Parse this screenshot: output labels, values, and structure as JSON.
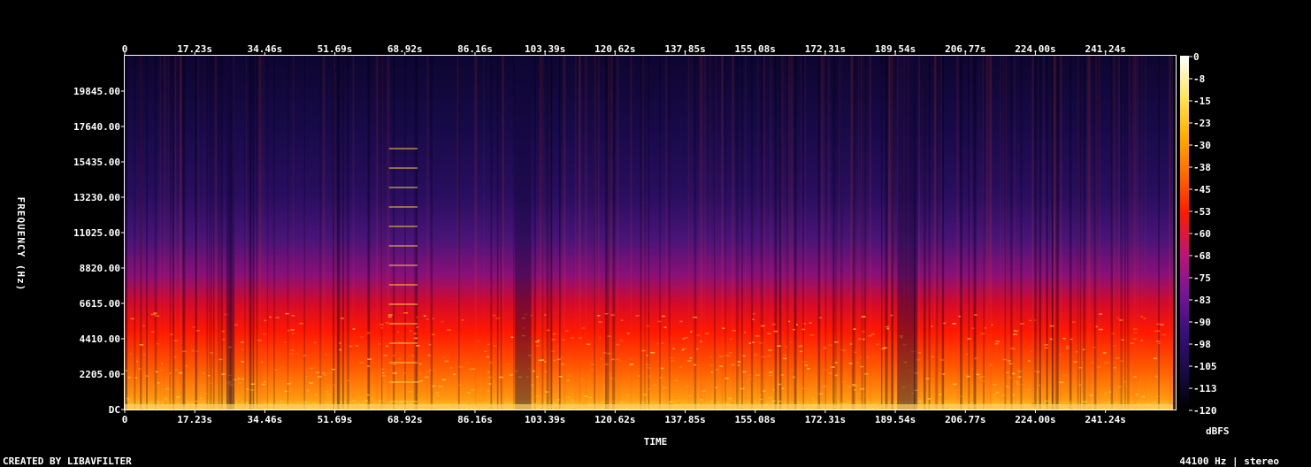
{
  "chart_data": {
    "type": "heatmap",
    "title": "",
    "xlabel": "TIME",
    "ylabel": "FREQUENCY (Hz)",
    "x_ticks": [
      "0",
      "17.23s",
      "34.46s",
      "51.69s",
      "68.92s",
      "86.16s",
      "103.39s",
      "120.62s",
      "137.85s",
      "155.08s",
      "172.31s",
      "189.54s",
      "206.77s",
      "224.00s",
      "241.24s"
    ],
    "x_tick_values": [
      0,
      17.23,
      34.46,
      51.69,
      68.92,
      86.16,
      103.39,
      120.62,
      137.85,
      155.08,
      172.31,
      189.54,
      206.77,
      224.0,
      241.24
    ],
    "xlim": [
      0,
      258.5
    ],
    "y_ticks": [
      "DC",
      "2205.00",
      "4410.00",
      "6615.00",
      "8820.00",
      "11025.00",
      "13230.00",
      "15435.00",
      "17640.00",
      "19845.00"
    ],
    "y_tick_values": [
      0,
      2205,
      4410,
      6615,
      8820,
      11025,
      13230,
      15435,
      17640,
      19845
    ],
    "ylim": [
      0,
      22050
    ],
    "colorbar": {
      "label": "dBFS",
      "ticks": [
        "0",
        "-8",
        "-15",
        "-23",
        "-30",
        "-38",
        "-45",
        "-53",
        "-60",
        "-68",
        "-75",
        "-83",
        "-90",
        "-98",
        "-105",
        "-113",
        "-120"
      ],
      "range": [
        -120,
        0
      ],
      "colors": [
        "#000000",
        "#1a0a45",
        "#3a0f7a",
        "#7a1496",
        "#c01474",
        "#ff1a00",
        "#ff6a00",
        "#ffb000",
        "#ffe860",
        "#ffffff"
      ]
    },
    "quiet_segments_seconds": [
      [
        25,
        27
      ],
      [
        96,
        100
      ],
      [
        190,
        195
      ]
    ],
    "bright_tone_segments_seconds": [
      [
        65,
        72
      ]
    ]
  },
  "footer": {
    "left": "CREATED BY LIBAVFILTER",
    "right": "44100 Hz | stereo"
  }
}
